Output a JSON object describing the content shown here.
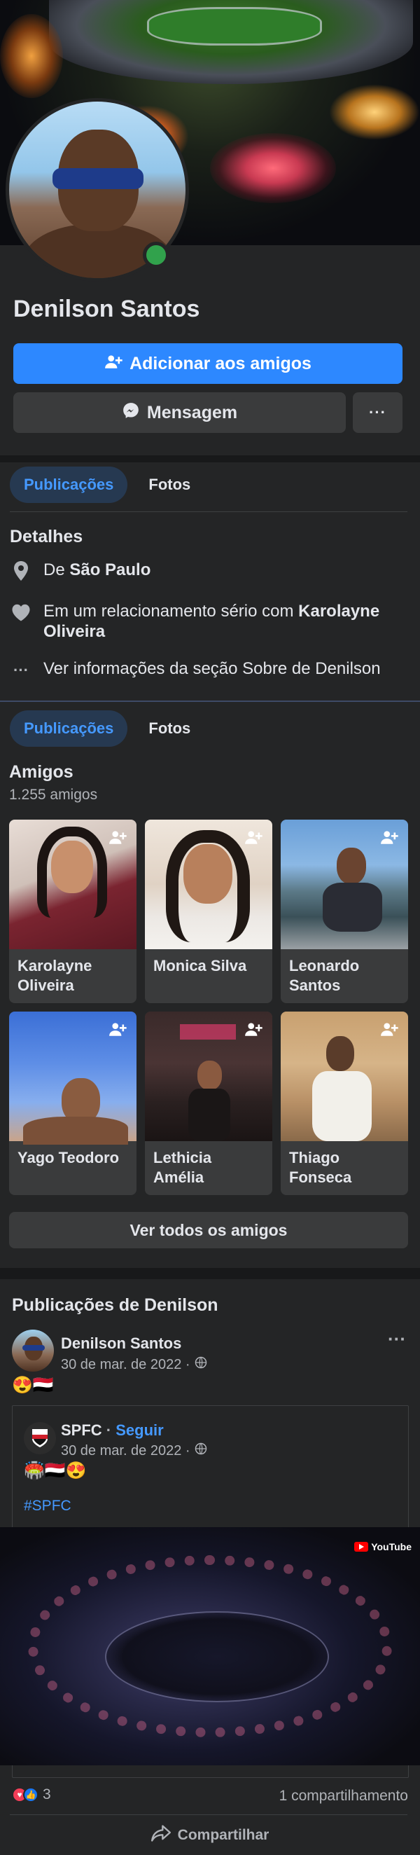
{
  "profile": {
    "name": "Denilson Santos",
    "add_friend_label": "Adicionar aos amigos",
    "message_label": "Mensagem",
    "more_label": "···"
  },
  "tabs": {
    "posts": "Publicações",
    "photos": "Fotos"
  },
  "details": {
    "title": "Detalhes",
    "hometown_prefix": "De ",
    "hometown": "São Paulo",
    "relationship_prefix": "Em um relacionamento sério com ",
    "relationship_partner": "Karolayne Oliveira",
    "see_about": "Ver informações da seção Sobre de Denilson"
  },
  "friends": {
    "title": "Amigos",
    "count": "1.255 amigos",
    "see_all": "Ver todos os amigos",
    "items": [
      {
        "name": "Karolayne Oliveira"
      },
      {
        "name": "Monica Silva"
      },
      {
        "name": "Leonardo Santos"
      },
      {
        "name": "Yago Teodoro"
      },
      {
        "name": "Lethicia Amélia"
      },
      {
        "name": "Thiago Fonseca"
      }
    ]
  },
  "posts_section": {
    "title": "Publicações de Denilson",
    "post": {
      "author": "Denilson Santos",
      "date": "30 de mar. de 2022 ·",
      "emojis": "😍🇾🇪",
      "more": "···",
      "shared": {
        "page": "SPFC",
        "dot": " · ",
        "follow": "Seguir",
        "date": "30 de mar. de 2022 ·",
        "emojis": "🏟️🇾🇪😍",
        "hashtag": "#SPFC"
      },
      "video_badge": "YouTube",
      "reaction_count": "3",
      "shares": "1 compartilhamento",
      "share_label": "Compartilhar"
    }
  },
  "colors": {
    "accent": "#2d88ff",
    "tab_active_bg": "#263951",
    "tab_active_text": "#4599ff",
    "online": "#31a24c",
    "card": "#242526",
    "page": "#18191a"
  },
  "icons": [
    "add-friend-icon",
    "messenger-icon",
    "location-pin-icon",
    "heart-icon",
    "more-dots-icon",
    "globe-icon",
    "share-icon",
    "like-icon",
    "love-icon"
  ]
}
